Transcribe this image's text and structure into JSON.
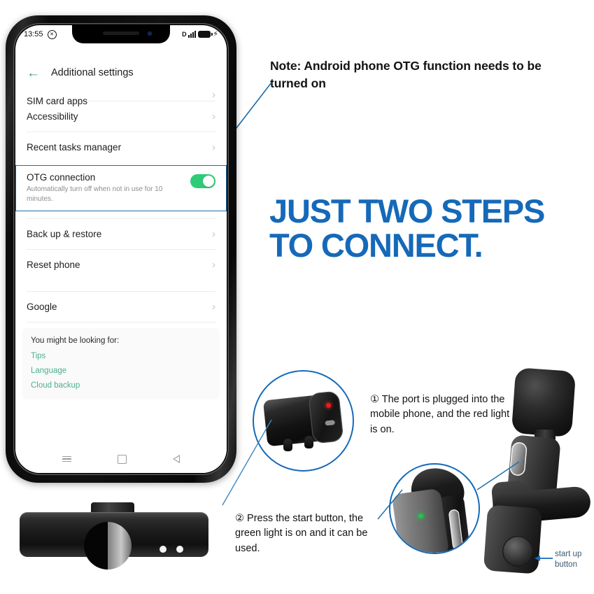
{
  "phone": {
    "status_bar": {
      "time": "13:55",
      "mute_icon": "mute-circle-icon",
      "network_label": "D",
      "signal_icon": "signal-bars-icon",
      "battery_icon": "battery-icon",
      "charging_icon": "lightning-bolt-icon"
    },
    "app_header": {
      "back_icon": "back-arrow-icon",
      "title": "Additional settings"
    },
    "settings_rows": [
      {
        "label": "SIM card apps",
        "chevron": "›",
        "clipped": true
      },
      {
        "label": "Accessibility",
        "chevron": "›"
      },
      {
        "label": "Recent tasks manager",
        "chevron": "›"
      }
    ],
    "otg": {
      "title": "OTG connection",
      "subtitle": "Automatically turn off when not in use for 10 minutes.",
      "toggle_state": "on",
      "toggle_color": "#2ecc78",
      "highlight_color": "#1d6ca8"
    },
    "settings_rows_2": [
      {
        "label": "Back up & restore",
        "chevron": "›"
      },
      {
        "label": "Reset phone",
        "chevron": "›"
      }
    ],
    "settings_rows_3": [
      {
        "label": "Google",
        "chevron": "›"
      }
    ],
    "suggestions": {
      "title": "You might be looking for:",
      "links": [
        "Tips",
        "Language",
        "Cloud backup"
      ],
      "link_color": "#4cb08a"
    },
    "navbar": {
      "menu_icon": "hamburger-menu-icon",
      "home_icon": "home-square-icon",
      "back_icon": "back-triangle-icon"
    }
  },
  "annotations": {
    "note": "Note: Android phone OTG function needs to be turned on",
    "headline_line1": "JUST TWO STEPS",
    "headline_line2": "TO CONNECT.",
    "headline_color": "#1569b8",
    "step1": "① The port is plugged into the mobile phone, and the red light is on.",
    "step2": "② Press the start button, the green light is on and it can be used.",
    "startup_label": "start up button",
    "startup_arrow_icon": "left-arrow-icon"
  },
  "product": {
    "receiver_dongle": "usb-receiver-dongle",
    "receiver_led_color": "#e0211e",
    "mic_led_color": "#24c24a",
    "circle_callout_1": "receiver-red-light-callout",
    "circle_callout_2": "mic-green-light-callout",
    "microphone": "lavalier-microphone",
    "callout_border_color": "#1569b8"
  }
}
